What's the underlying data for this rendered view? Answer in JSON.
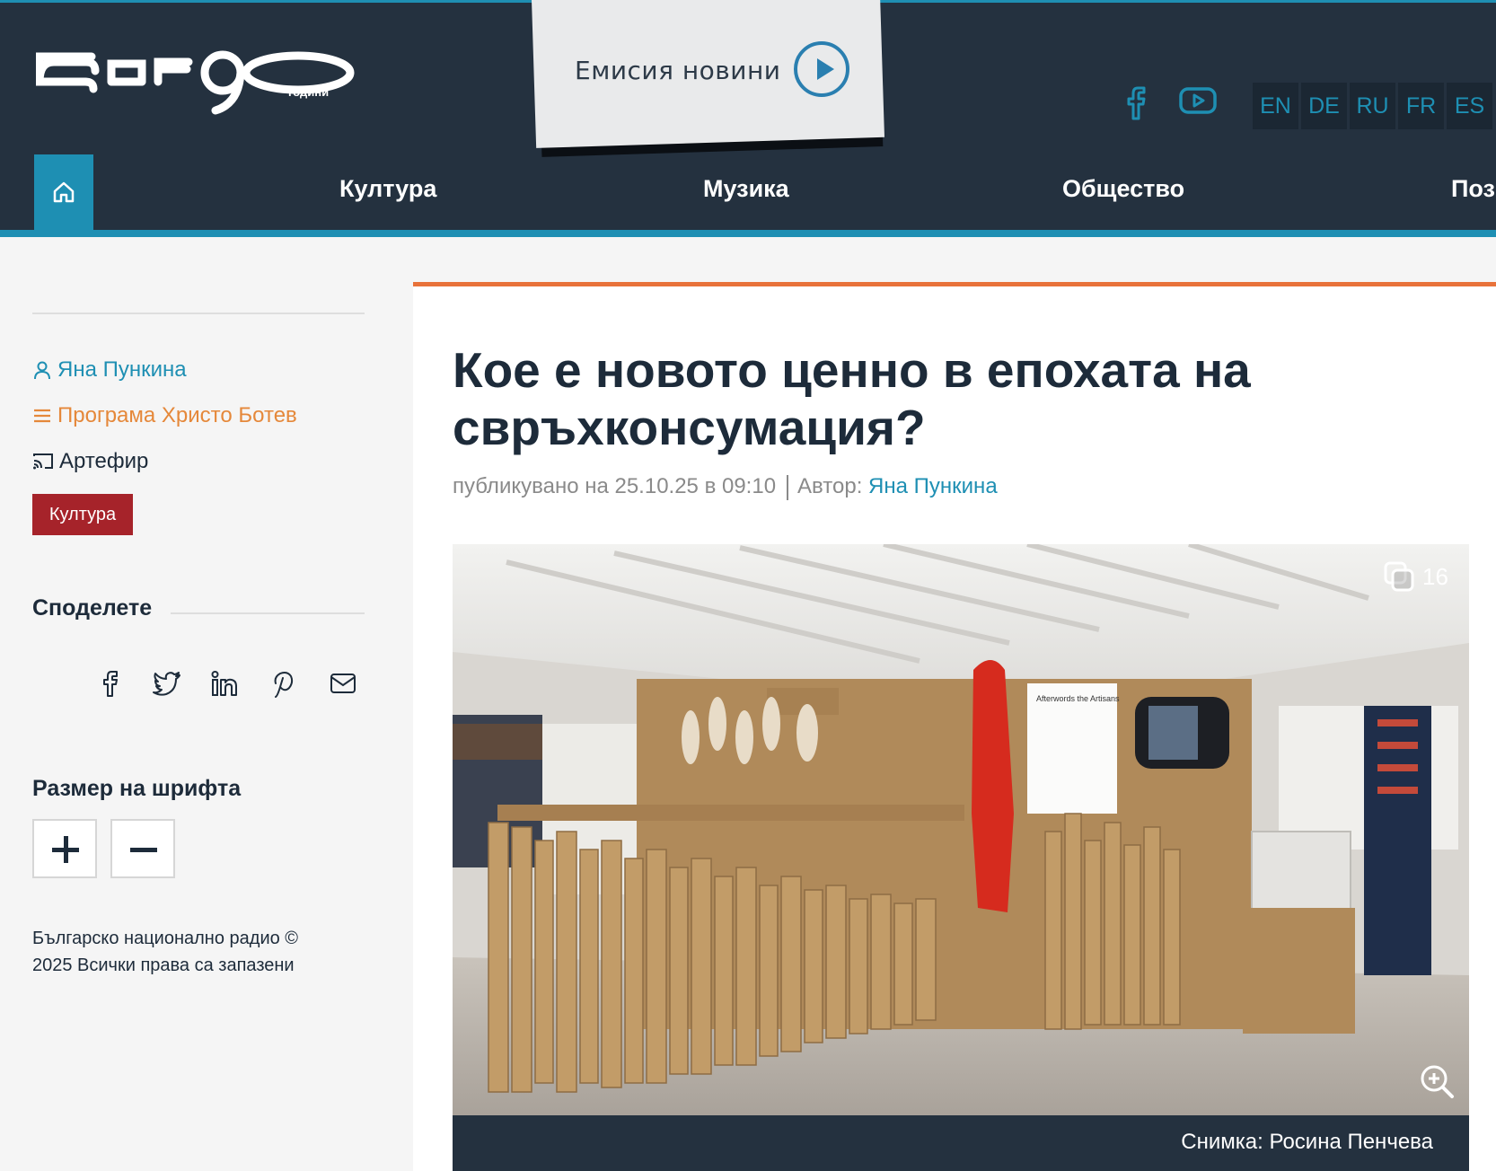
{
  "header": {
    "logo_text": "БНР90",
    "logo_subtitle": "години",
    "news_label": "Емисия новини",
    "languages": [
      "EN",
      "DE",
      "RU",
      "FR",
      "ES"
    ],
    "nav": [
      "Култура",
      "Музика",
      "Общество",
      "Поз"
    ],
    "accent_color": "#1e8fb3",
    "background_color": "#24313f"
  },
  "sidebar": {
    "author": "Яна Пункина",
    "program": "Програма Христо Ботев",
    "show": "Артефир",
    "tag": "Култура",
    "share_title": "Споделете",
    "share_icons": [
      "facebook-icon",
      "twitter-icon",
      "linkedin-icon",
      "pinterest-icon",
      "mail-icon"
    ],
    "font_size_title": "Размер на шрифта",
    "font_plus": "+",
    "font_minus": "−",
    "copyright": "Българско национално радио © 2025 Всички права са запазени"
  },
  "article": {
    "title": "Кое е новото ценно в епохата на свръхконсумация?",
    "published": "публикувано на 25.10.25 в 09:10",
    "author_label": "Автор:",
    "author_name": "Яна Пункина",
    "gallery_count": "16",
    "photo_caption": "Снимка: Росина Пенчева",
    "photo_wall_text": "Afterwords the Artisans"
  }
}
